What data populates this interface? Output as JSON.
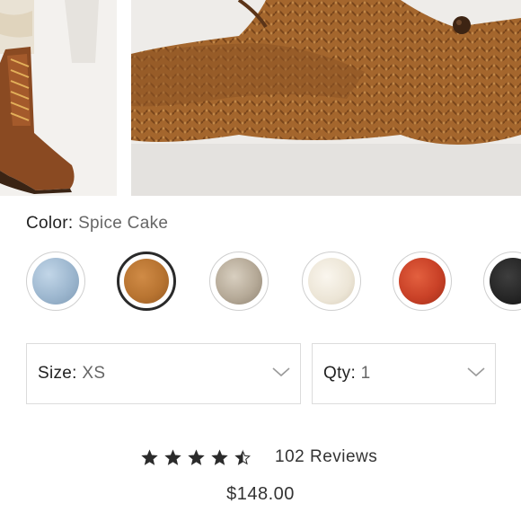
{
  "gallery": {
    "images": [
      {
        "name": "product-thumb-boots",
        "icon": "lace-up-boot-photo"
      },
      {
        "name": "product-main-sweater",
        "icon": "cable-knit-sweater-photo"
      }
    ]
  },
  "color": {
    "label": "Color:",
    "selected": "Spice Cake",
    "swatches": [
      {
        "id": "blue",
        "hex": "#9db7cf",
        "selected": false
      },
      {
        "id": "spice-cake",
        "hex": "#b87431",
        "selected": true
      },
      {
        "id": "oatmeal",
        "hex": "#b6aa98",
        "selected": false
      },
      {
        "id": "ivory",
        "hex": "#ece5d6",
        "selected": false
      },
      {
        "id": "red",
        "hex": "#c94127",
        "selected": false
      },
      {
        "id": "black",
        "hex": "#262626",
        "selected": false
      }
    ]
  },
  "size": {
    "label": "Size:",
    "value": "XS"
  },
  "qty": {
    "label": "Qty:",
    "value": "1"
  },
  "rating": {
    "stars": 4.5,
    "max": 5,
    "reviews_text": "102 Reviews"
  },
  "price": "$148.00",
  "colors": {
    "text": "#333333",
    "muted": "#666666",
    "border": "#dcdcdc",
    "selected_ring": "#2a2a2a"
  }
}
